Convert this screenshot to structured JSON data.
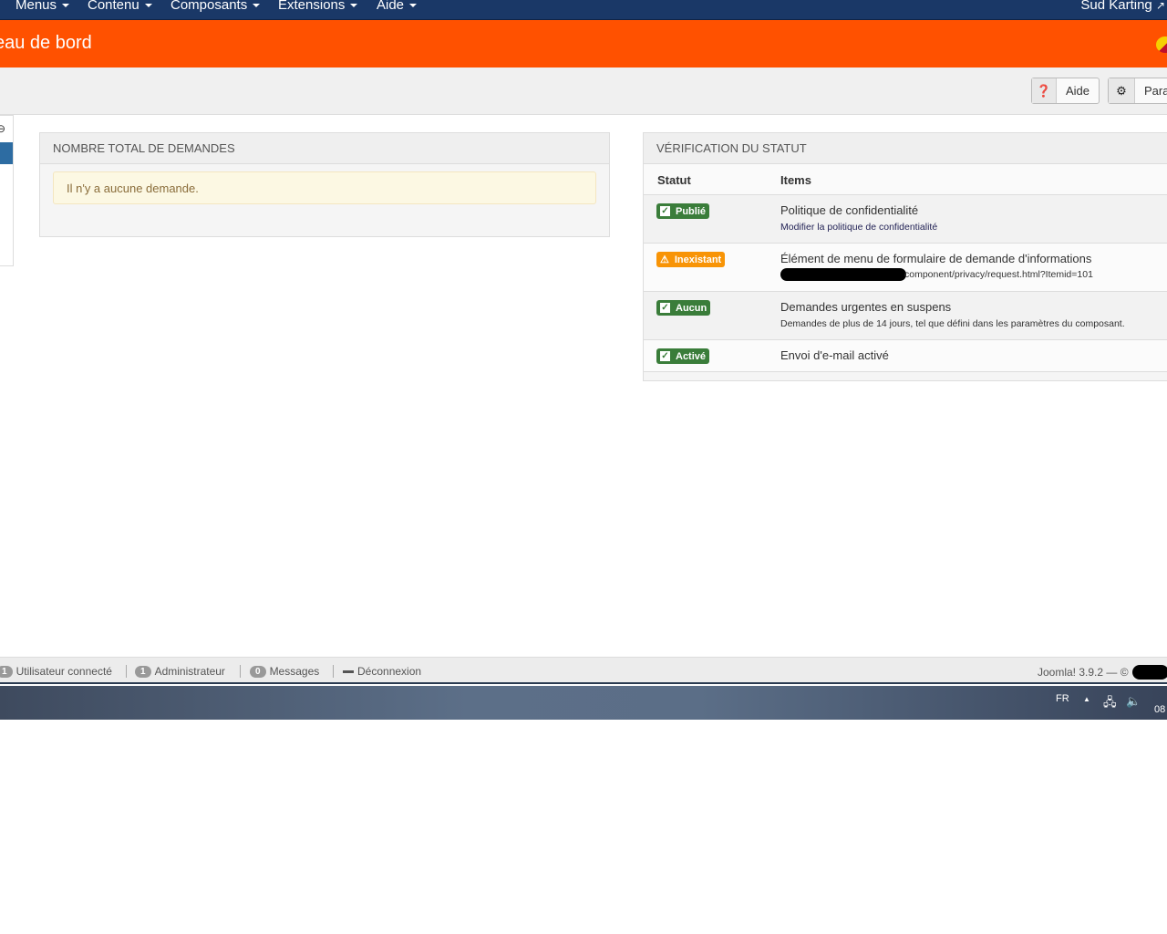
{
  "nav": {
    "items": [
      "Menus",
      "Contenu",
      "Composants",
      "Extensions",
      "Aide"
    ],
    "site": "Sud Karting"
  },
  "header": {
    "title": "eau de bord"
  },
  "toolbar": {
    "help": "Aide",
    "options": "Para"
  },
  "requests_panel": {
    "title": "Nombre total de demandes",
    "message": "Il n'y a aucune demande."
  },
  "status_panel": {
    "title": "Vérification du statut",
    "columns": [
      "Statut",
      "Items"
    ],
    "rows": [
      {
        "badge": "Publié",
        "color": "#3a7d3a",
        "icon": "checkbox-icon",
        "title": "Politique de confidentialité",
        "sub": "Modifier la politique de confidentialité"
      },
      {
        "badge": "Inexistant",
        "color": "#f89406",
        "icon": "warning-icon",
        "title": "Élément de menu de formulaire de demande d'informations",
        "sub": "component/privacy/request.html?Itemid=101"
      },
      {
        "badge": "Aucun",
        "color": "#3a7d3a",
        "icon": "checkbox-icon",
        "title": "Demandes urgentes en suspens",
        "sub": "Demandes de plus de 14 jours, tel que défini dans les paramètres du composant."
      },
      {
        "badge": "Activé",
        "color": "#3a7d3a",
        "icon": "checkbox-icon",
        "title": "Envoi d'e-mail activé",
        "sub": ""
      }
    ]
  },
  "statusbar": {
    "users_count": "1",
    "users_label": "Utilisateur connecté",
    "admin_count": "1",
    "admin_label": "Administrateur",
    "messages_count": "0",
    "messages_label": "Messages",
    "logout": "Déconnexion",
    "version": "Joomla! 3.9.2 — ©"
  },
  "taskbar": {
    "lang": "FR",
    "clock": "08"
  },
  "colors": {
    "navbar": "#1a3867",
    "header": "#ff5100",
    "success": "#3a7d3a",
    "warning": "#f89406"
  }
}
